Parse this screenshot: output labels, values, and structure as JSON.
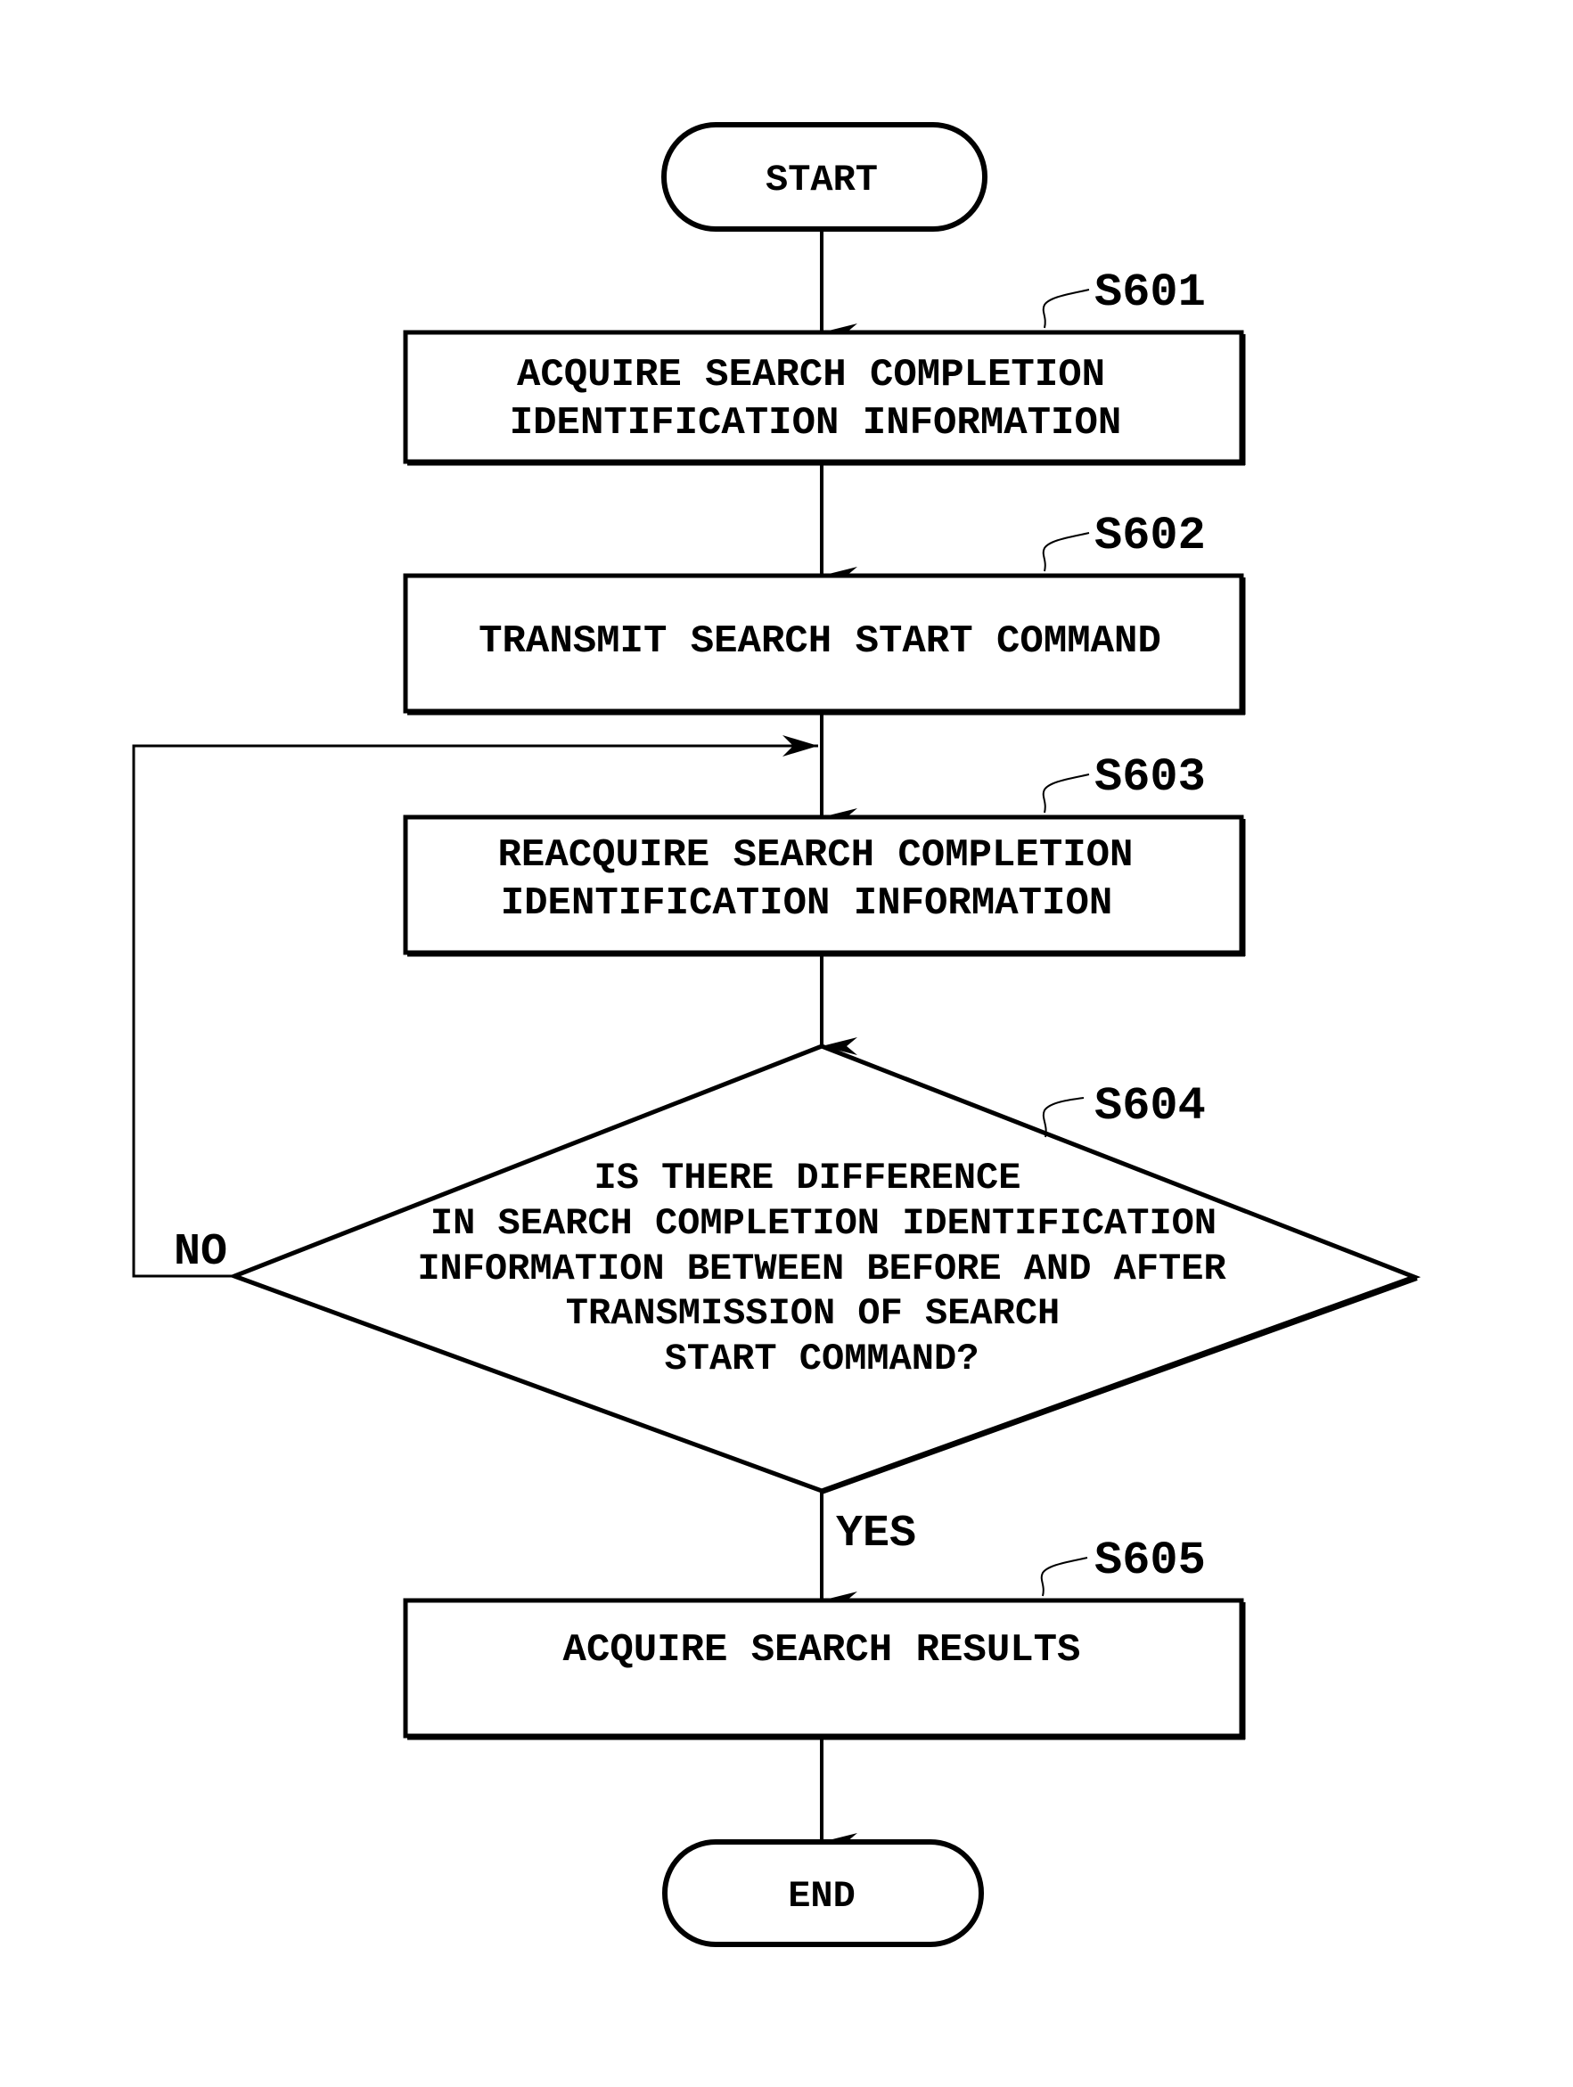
{
  "figure": {
    "type": "flowchart",
    "colors": {
      "stroke": "#000000",
      "background": "#ffffff",
      "text": "#000000"
    }
  },
  "nodes": {
    "start": {
      "kind": "terminator",
      "text": "START"
    },
    "s601": {
      "kind": "process",
      "step": "S601",
      "lines": [
        "ACQUIRE SEARCH COMPLETION",
        "IDENTIFICATION INFORMATION"
      ]
    },
    "s602": {
      "kind": "process",
      "step": "S602",
      "lines": [
        "TRANSMIT SEARCH START COMMAND"
      ]
    },
    "s603": {
      "kind": "process",
      "step": "S603",
      "lines": [
        "REACQUIRE SEARCH COMPLETION",
        "IDENTIFICATION INFORMATION"
      ]
    },
    "s604": {
      "kind": "decision",
      "step": "S604",
      "lines": [
        "IS THERE DIFFERENCE",
        "IN SEARCH COMPLETION IDENTIFICATION",
        "INFORMATION BETWEEN BEFORE AND AFTER",
        "TRANSMISSION OF SEARCH",
        "START COMMAND?"
      ]
    },
    "s605": {
      "kind": "process",
      "step": "S605",
      "lines": [
        "ACQUIRE SEARCH RESULTS"
      ]
    },
    "end": {
      "kind": "terminator",
      "text": "END"
    }
  },
  "edges": [
    {
      "from": "start",
      "to": "s601",
      "label": ""
    },
    {
      "from": "s601",
      "to": "s602",
      "label": ""
    },
    {
      "from": "s602",
      "to": "s603",
      "label": ""
    },
    {
      "from": "s603",
      "to": "s604",
      "label": ""
    },
    {
      "from": "s604",
      "to": "s603",
      "label": "NO"
    },
    {
      "from": "s604",
      "to": "s605",
      "label": "YES"
    },
    {
      "from": "s605",
      "to": "end",
      "label": ""
    }
  ],
  "branch_labels": {
    "no": "NO",
    "yes": "YES"
  }
}
